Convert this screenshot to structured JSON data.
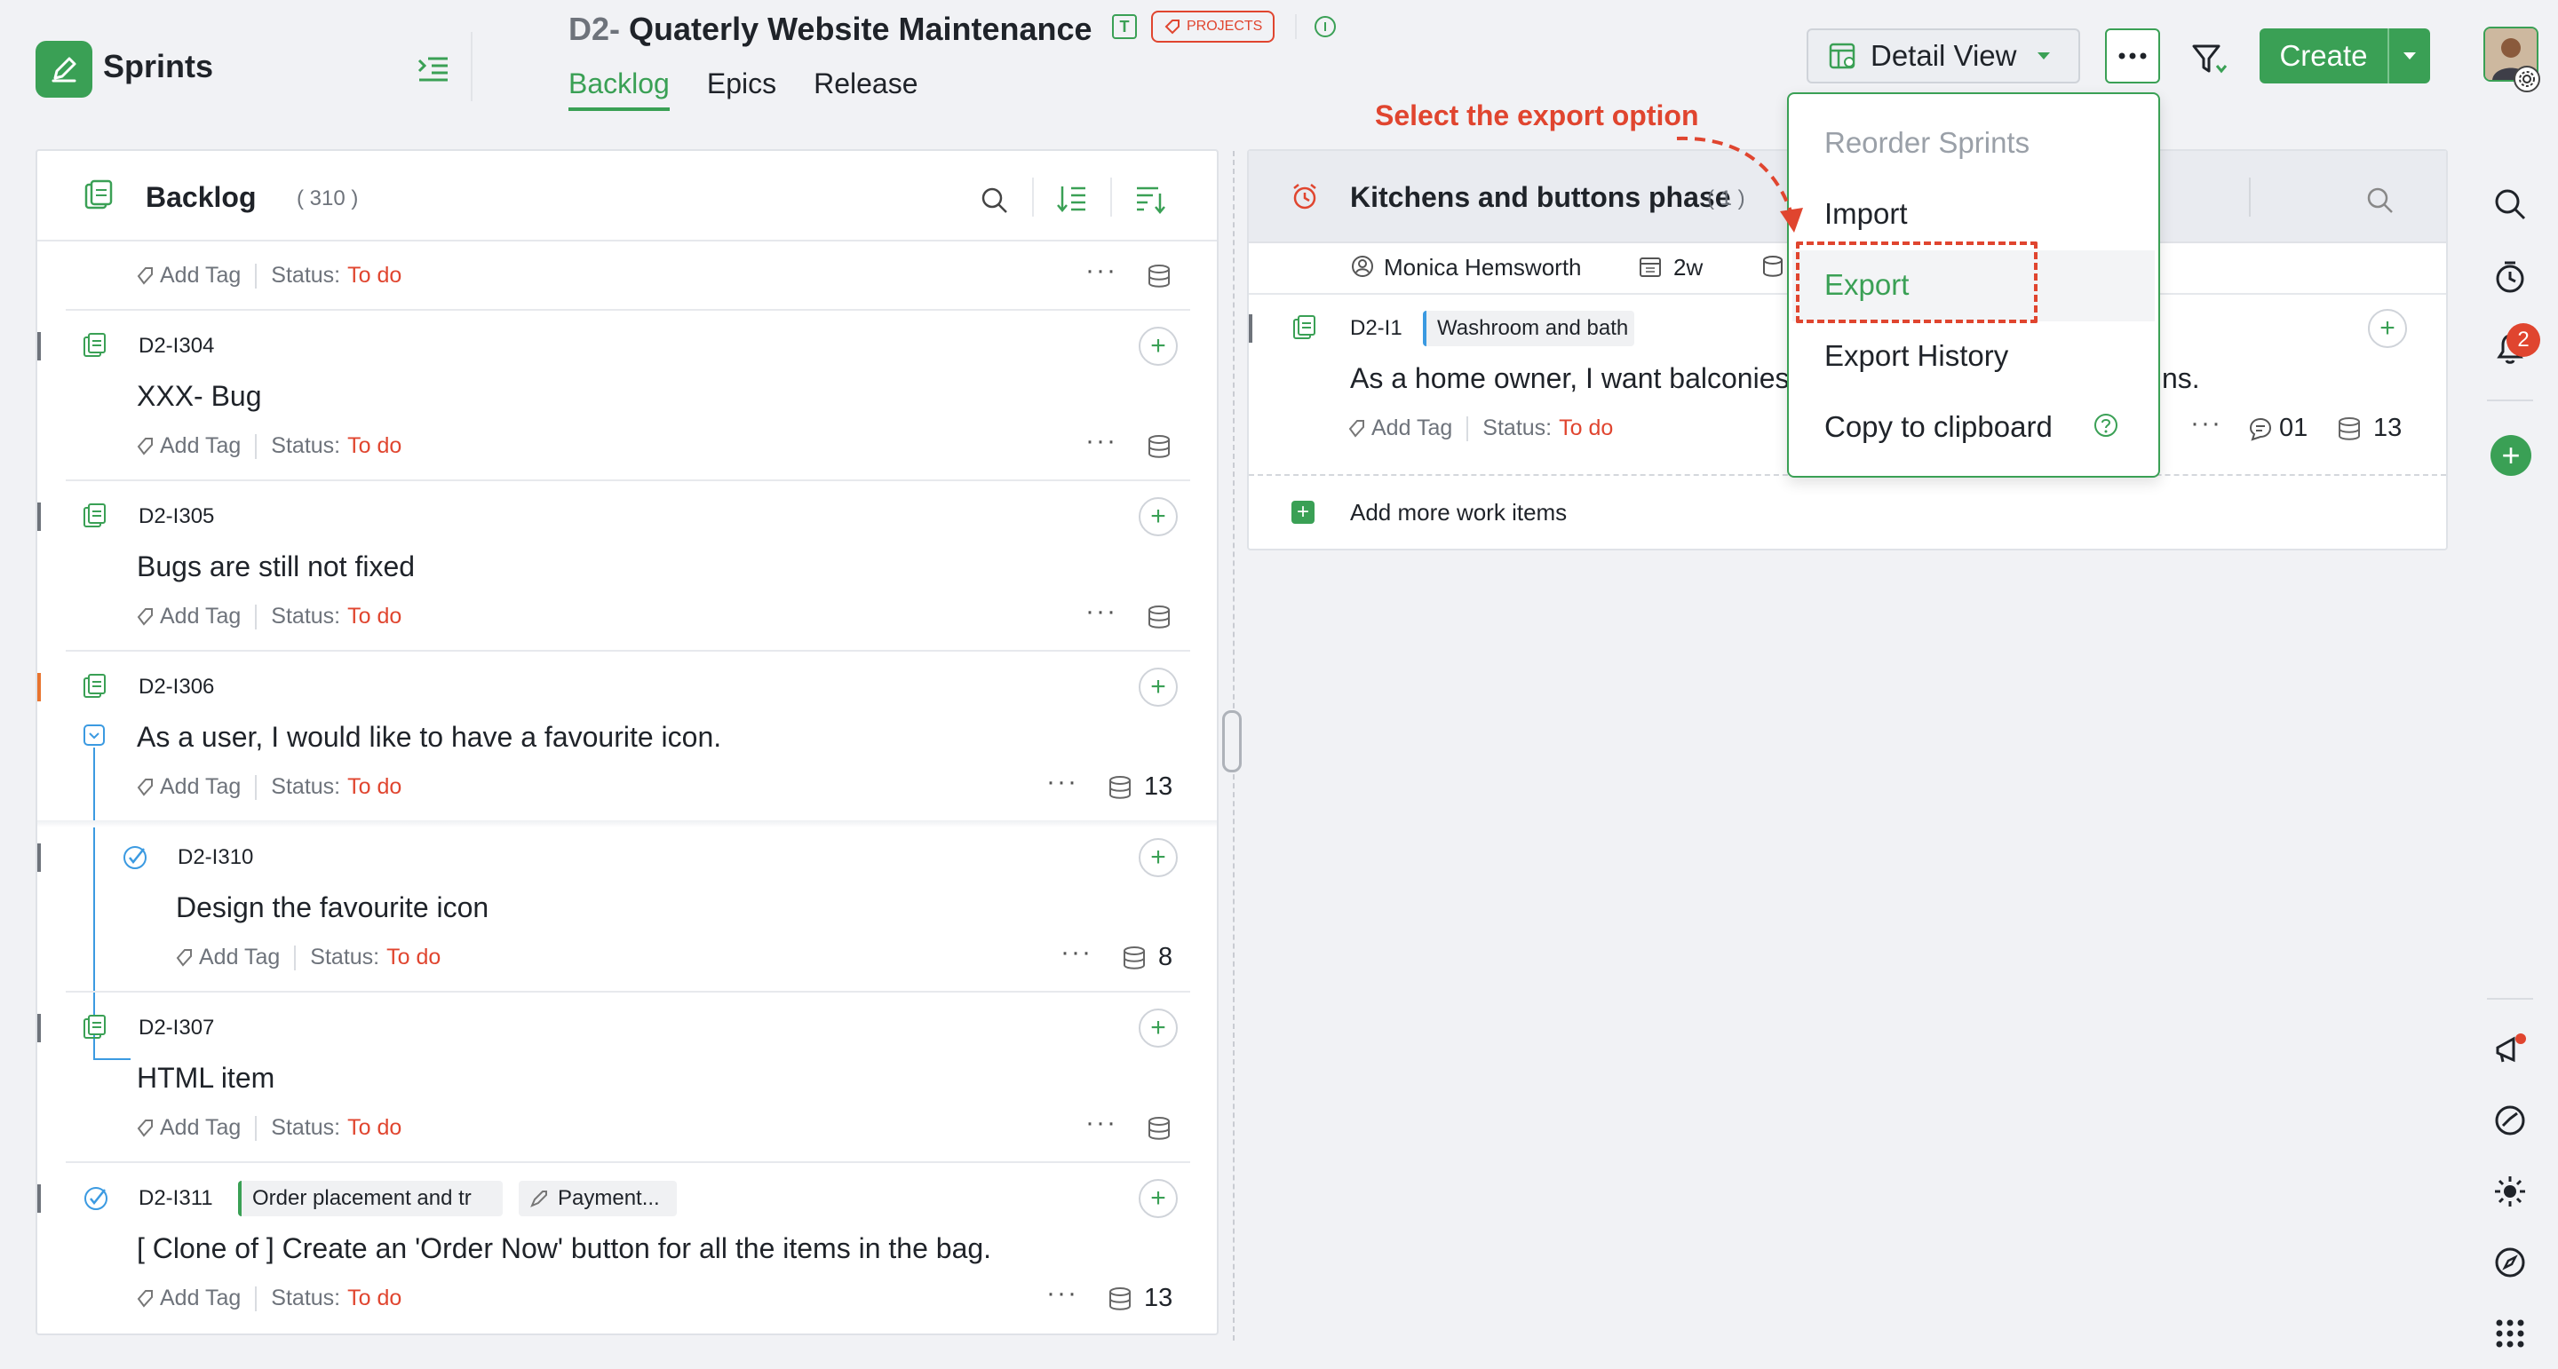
{
  "app": {
    "name": "Sprints"
  },
  "project": {
    "key": "D2-",
    "name": "Quaterly Website Maintenance",
    "type_badge": "T",
    "category_badge": "PROJECTS"
  },
  "nav": {
    "tabs": [
      "Backlog",
      "Epics",
      "Release"
    ],
    "active": "Backlog"
  },
  "toolbar": {
    "view_label": "Detail View",
    "create_label": "Create"
  },
  "backlog": {
    "title": "Backlog",
    "count": "( 310 )",
    "add_tag": "Add Tag",
    "status_label": "Status:",
    "items": [
      {
        "id": "",
        "title": "",
        "status": "To do",
        "points": ""
      },
      {
        "id": "D2-I304",
        "title": "XXX- Bug",
        "status": "To do",
        "points": ""
      },
      {
        "id": "D2-I305",
        "title": "Bugs are still not fixed",
        "status": "To do",
        "points": ""
      },
      {
        "id": "D2-I306",
        "title": "As a user, I would like to have a favourite icon.",
        "status": "To do",
        "points": "13"
      },
      {
        "id": "D2-I310",
        "title": "Design the favourite icon",
        "status": "To do",
        "points": "8"
      },
      {
        "id": "D2-I307",
        "title": "HTML item",
        "status": "To do",
        "points": ""
      },
      {
        "id": "D2-I311",
        "title": "[ Clone of ] Create an 'Order Now' button for all the items in the bag.",
        "status": "To do",
        "points": "13",
        "tags": [
          "Order placement and tr",
          "Payment..."
        ]
      }
    ]
  },
  "sprint": {
    "title": "Kitchens and buttons phase",
    "count": "( 1 )",
    "owner": "Monica Hemsworth",
    "duration": "2w",
    "item": {
      "id": "D2-I1",
      "tag": "Washroom and bath",
      "title_start": "As a home owner, I want balconies",
      "title_end": "ns.",
      "add_tag": "Add Tag",
      "status_label": "Status:",
      "status": "To do",
      "comments": "01",
      "points": "13"
    },
    "add_more": "Add more work items"
  },
  "menu": {
    "items": [
      "Reorder Sprints",
      "Import",
      "Export",
      "Export History",
      "Copy to clipboard"
    ],
    "disabled": "Reorder Sprints",
    "highlighted": "Export"
  },
  "annotation": {
    "callout": "Select the export option"
  },
  "notifications": {
    "count": "2"
  },
  "colors": {
    "accent": "#3aa055",
    "danger": "#e0452f",
    "status_todo": "#e0452f"
  }
}
